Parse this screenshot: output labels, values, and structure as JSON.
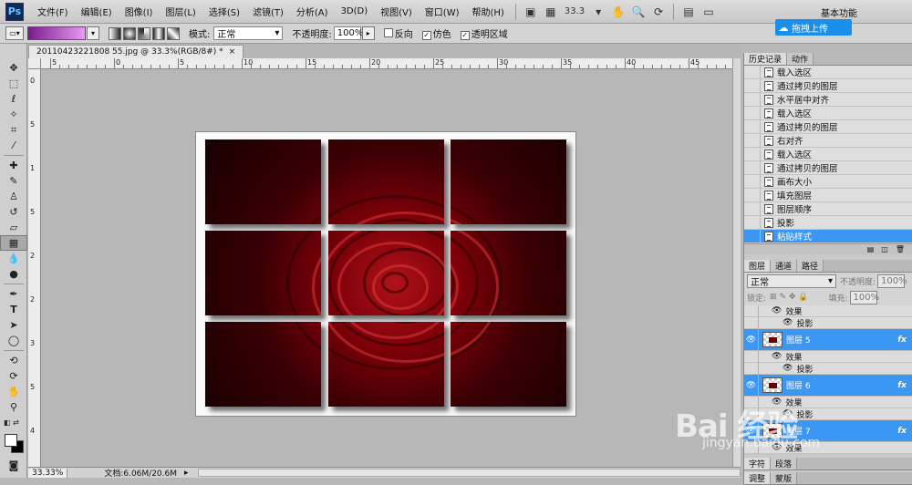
{
  "menubar": {
    "logo": "Ps",
    "items": [
      "文件(F)",
      "编辑(E)",
      "图像(I)",
      "图层(L)",
      "选择(S)",
      "滤镜(T)",
      "分析(A)",
      "3D(D)",
      "视图(V)",
      "窗口(W)",
      "帮助(H)"
    ],
    "zoom": "33.3",
    "workspace": "基本功能",
    "baidu_upload": "拖拽上传"
  },
  "options": {
    "mode_label": "模式:",
    "mode_value": "正常",
    "opacity_label": "不透明度:",
    "opacity_value": "100%",
    "reverse_label": "反向",
    "dither_label": "仿色",
    "transparency_label": "透明区域",
    "dither_checked": true,
    "transparency_checked": true,
    "gradient_colors": [
      "#7a1a8a",
      "#e79cf2"
    ]
  },
  "document": {
    "tab_title": "20110423221808 55.jpg @ 33.3%(RGB/8#) *",
    "ruler_h_labels": [
      "5",
      "0",
      "5",
      "10",
      "15",
      "20",
      "25",
      "30",
      "35",
      "40",
      "45",
      "50"
    ],
    "ruler_v_labels": [
      "0",
      "5",
      "1",
      "5",
      "2",
      "2",
      "3",
      "5",
      "4"
    ],
    "status_zoom": "33.33%",
    "status_doc": "文档:6.06M/20.6M"
  },
  "history": {
    "tabs": [
      "历史记录",
      "动作"
    ],
    "items": [
      "载入选区",
      "通过拷贝的图层",
      "水平居中对齐",
      "载入选区",
      "通过拷贝的图层",
      "右对齐",
      "载入选区",
      "通过拷贝的图层",
      "画布大小",
      "填充图层",
      "图层顺序",
      "投影",
      "粘贴样式"
    ],
    "selected_index": 12
  },
  "layers": {
    "tabs": [
      "图层",
      "通道",
      "路径"
    ],
    "blend_mode": "正常",
    "opacity_label": "不透明度:",
    "opacity_value": "100%",
    "lock_label": "锁定:",
    "fill_label": "填充:",
    "fill_value": "100%",
    "rows": [
      {
        "kind": "effect",
        "label": "效果"
      },
      {
        "kind": "effect-item",
        "label": "投影"
      },
      {
        "kind": "layer",
        "label": "图层 5",
        "selected": true
      },
      {
        "kind": "effect",
        "label": "效果"
      },
      {
        "kind": "effect-item",
        "label": "投影"
      },
      {
        "kind": "layer",
        "label": "图层 6",
        "selected": true
      },
      {
        "kind": "effect",
        "label": "效果"
      },
      {
        "kind": "effect-item",
        "label": "投影"
      },
      {
        "kind": "layer",
        "label": "图层 7",
        "selected": true
      },
      {
        "kind": "effect",
        "label": "效果"
      }
    ],
    "fx_label": "fx"
  },
  "bottom_tabs": [
    "字符",
    "段落"
  ],
  "bottom_tabs2": [
    "调整",
    "蒙版"
  ],
  "watermark": {
    "text": "Bai 经验",
    "sub": "jingyan.baidu.com"
  }
}
